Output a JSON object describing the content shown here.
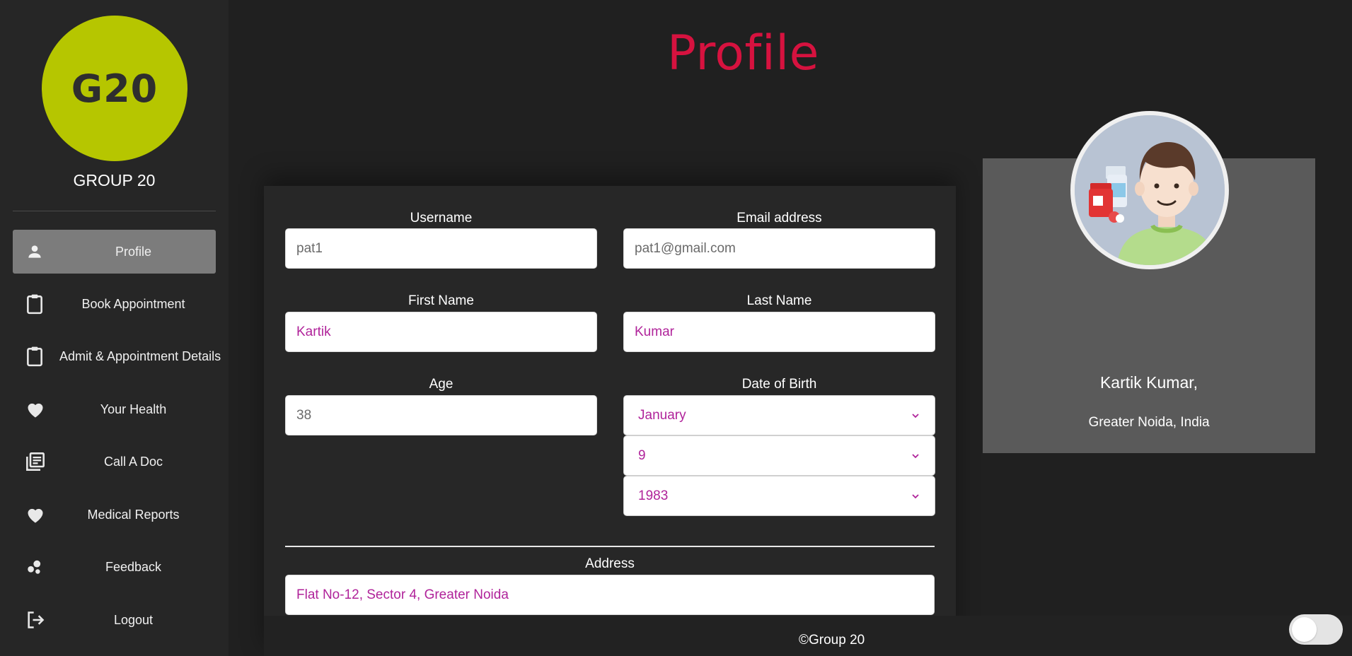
{
  "sidebar": {
    "logo_text": "G20",
    "group_name": "GROUP 20",
    "items": [
      {
        "label": "Profile",
        "icon": "person-icon",
        "active": true
      },
      {
        "label": "Book Appointment",
        "icon": "clipboard-icon"
      },
      {
        "label": "Admit & Appointment Details",
        "icon": "clipboard-icon"
      },
      {
        "label": "Your Health",
        "icon": "heart-icon"
      },
      {
        "label": "Call A Doc",
        "icon": "library-books-icon"
      },
      {
        "label": "Medical Reports",
        "icon": "heart-icon"
      },
      {
        "label": "Feedback",
        "icon": "bubbles-icon"
      },
      {
        "label": "Logout",
        "icon": "logout-icon"
      }
    ]
  },
  "header": {
    "title": "Profile"
  },
  "form": {
    "username": {
      "label": "Username",
      "value": "pat1"
    },
    "email": {
      "label": "Email address",
      "value": "pat1@gmail.com"
    },
    "first_name": {
      "label": "First Name",
      "value": "Kartik"
    },
    "last_name": {
      "label": "Last Name",
      "value": "Kumar"
    },
    "age": {
      "label": "Age",
      "value": "38"
    },
    "dob": {
      "label": "Date of Birth",
      "month": "January",
      "day": "9",
      "year": "1983"
    },
    "address": {
      "label": "Address",
      "value": "Flat No-12, Sector 4, Greater Noida"
    }
  },
  "profile_card": {
    "name": "Kartik Kumar,",
    "location": "Greater Noida, India",
    "avatar_icon": "patient-avatar-icon"
  },
  "footer": {
    "text": "©Group 20"
  },
  "colors": {
    "accent": "#d6123f",
    "logo_bg": "#b6c600",
    "input_text": "#b0239a",
    "active_nav": "#7c7c7c"
  }
}
